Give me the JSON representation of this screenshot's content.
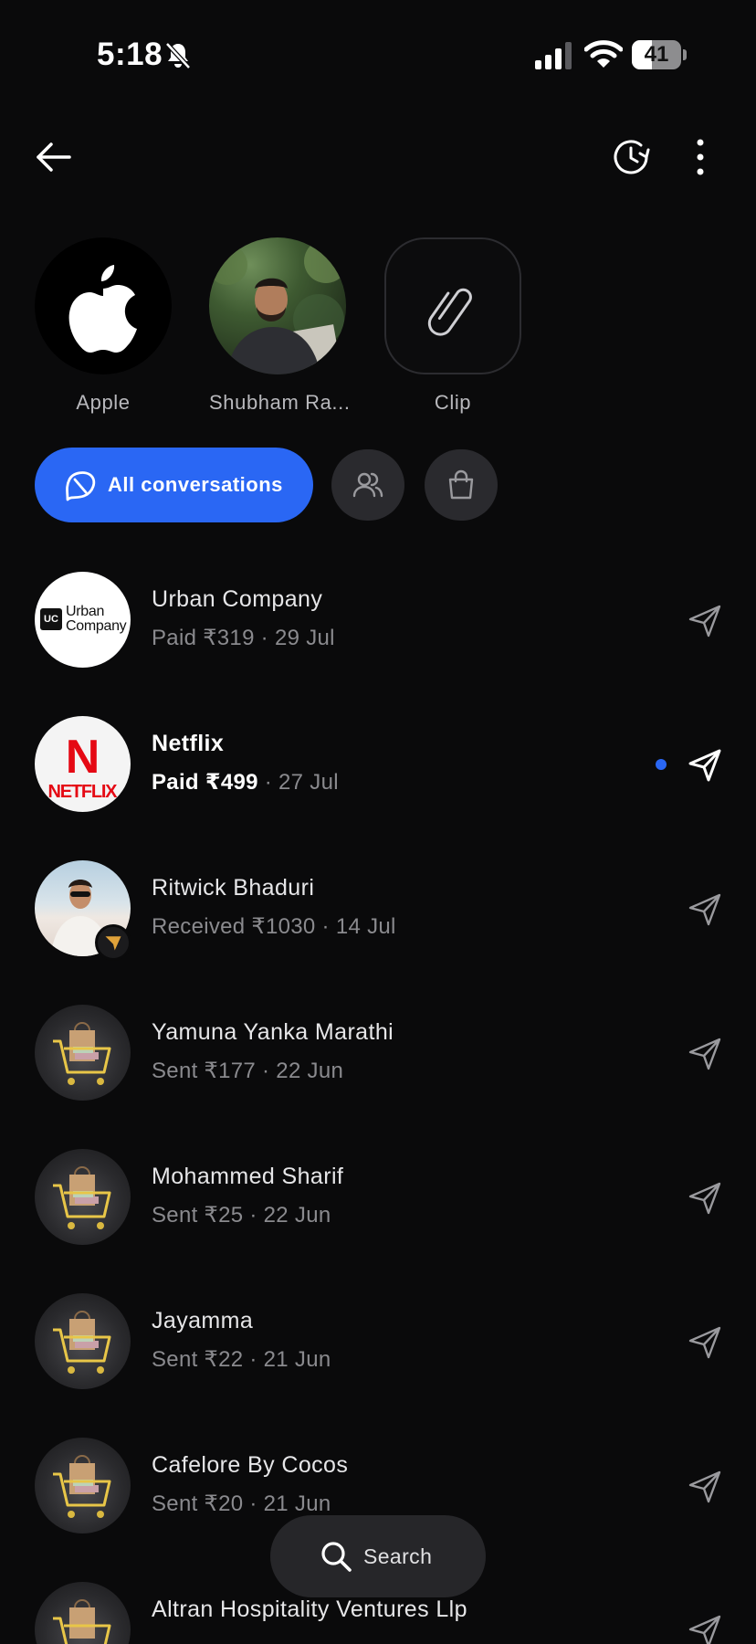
{
  "status_bar": {
    "time": "5:18",
    "battery": "41",
    "battery_level": 0.41,
    "icons": [
      "bell-slash-icon",
      "cellular-signal-icon",
      "wifi-icon",
      "battery-icon"
    ]
  },
  "top_bar": {
    "icons": [
      "back-arrow-icon",
      "history-icon",
      "more-vertical-icon"
    ]
  },
  "quick_contacts": [
    {
      "label": "Apple",
      "icon": "apple-logo-icon"
    },
    {
      "label": "Shubham Ra...",
      "icon": "person-photo"
    },
    {
      "label": "Clip",
      "icon": "paperclip-icon"
    }
  ],
  "filters": {
    "active_label": "All conversations",
    "chips": [
      "group-icon",
      "shopping-bag-icon"
    ]
  },
  "conversations": [
    {
      "name": "Urban Company",
      "amount": "Paid ₹319",
      "date": " · 29 Jul",
      "unread": false,
      "avatar": "urban-company-logo"
    },
    {
      "name": "Netflix",
      "amount": "Paid ₹499",
      "date": " · 27 Jul",
      "unread": true,
      "avatar": "netflix-logo"
    },
    {
      "name": "Ritwick Bhaduri",
      "amount": "Received ₹1030",
      "date": " · 14 Jul",
      "unread": false,
      "avatar": "person-photo"
    },
    {
      "name": "Yamuna Yanka Marathi",
      "amount": "Sent ₹177",
      "date": " · 22 Jun",
      "unread": false,
      "avatar": "shopping-cart-image"
    },
    {
      "name": "Mohammed Sharif",
      "amount": "Sent ₹25",
      "date": " · 22 Jun",
      "unread": false,
      "avatar": "shopping-cart-image"
    },
    {
      "name": "Jayamma",
      "amount": "Sent ₹22",
      "date": " · 21 Jun",
      "unread": false,
      "avatar": "shopping-cart-image"
    },
    {
      "name": "Cafelore By Cocos",
      "amount": "Sent ₹20",
      "date": " · 21 Jun",
      "unread": false,
      "avatar": "shopping-cart-image"
    },
    {
      "name": "Altran Hospitality Ventures Llp",
      "amount": "",
      "date": "",
      "unread": false,
      "avatar": "shopping-cart-image"
    }
  ],
  "logos": {
    "urban_company_box": "UC",
    "urban_company_line1": "Urban",
    "urban_company_line2": "Company",
    "netflix_letter": "N",
    "netflix_word": "NETFLIX"
  },
  "search": {
    "label": "Search"
  },
  "colors": {
    "background": "#0a0a0b",
    "accent": "#2a67f4",
    "chip": "#2a2a2e",
    "muted_text": "#8a8a8e",
    "netflix_red": "#e50914"
  }
}
